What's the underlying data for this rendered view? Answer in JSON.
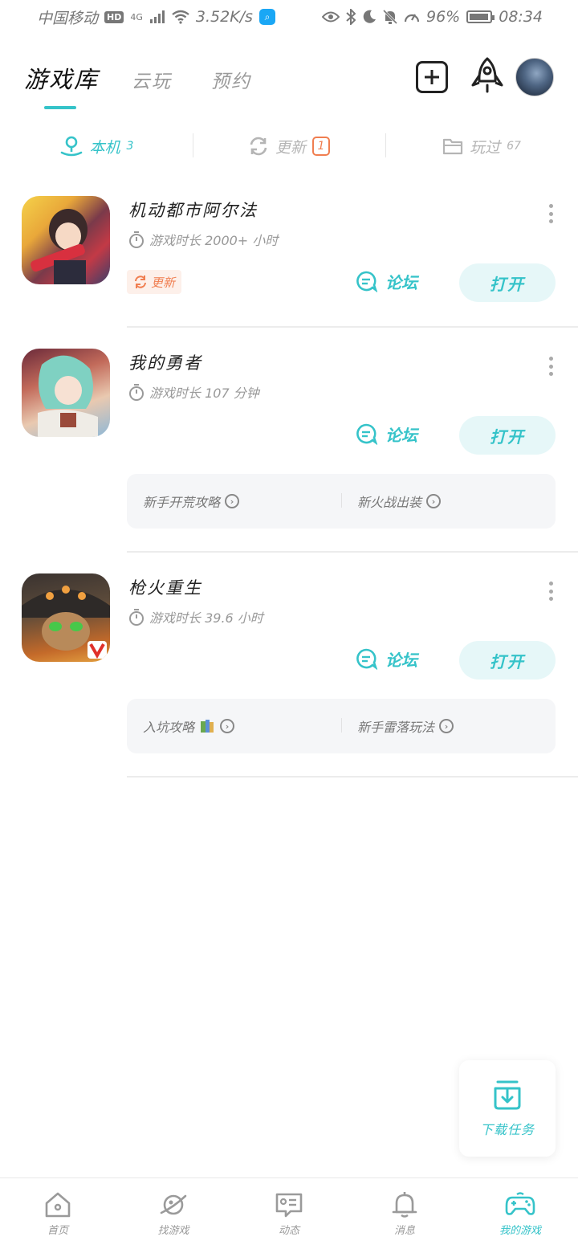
{
  "status_bar": {
    "carrier": "中国移动",
    "hd": "HD",
    "signal": "4G",
    "speed": "3.52K/s",
    "battery": "96%",
    "time": "08:34"
  },
  "header": {
    "tabs": [
      {
        "label": "游戏库",
        "active": true
      },
      {
        "label": "云玩",
        "active": false
      },
      {
        "label": "预约",
        "active": false
      }
    ]
  },
  "filters": [
    {
      "label": "本机",
      "count": "3",
      "active": true
    },
    {
      "label": "更新",
      "count": "1",
      "active": false
    },
    {
      "label": "玩过",
      "count": "67",
      "active": false
    }
  ],
  "games": [
    {
      "name": "机动都市阿尔法",
      "playtime": "游戏时长 2000+ 小时",
      "update_tag": "更新",
      "forum_label": "论坛",
      "open_label": "打开",
      "guides": []
    },
    {
      "name": "我的勇者",
      "playtime": "游戏时长 107 分钟",
      "forum_label": "论坛",
      "open_label": "打开",
      "guides": [
        "新手开荒攻略",
        "新火战出装"
      ]
    },
    {
      "name": "枪火重生",
      "playtime": "游戏时长 39.6 小时",
      "forum_label": "论坛",
      "open_label": "打开",
      "guides": [
        "入坑攻略",
        "新手雷落玩法"
      ]
    }
  ],
  "download_float": {
    "label": "下载任务"
  },
  "bottom_nav": [
    {
      "label": "首页",
      "icon": "home-icon",
      "active": false
    },
    {
      "label": "找游戏",
      "icon": "planet-icon",
      "active": false
    },
    {
      "label": "动态",
      "icon": "feed-icon",
      "active": false
    },
    {
      "label": "消息",
      "icon": "bell-icon",
      "active": false
    },
    {
      "label": "我的游戏",
      "icon": "gamepad-icon",
      "active": true
    }
  ],
  "colors": {
    "accent": "#35c3c9",
    "update": "#f07e50",
    "muted": "#9a9a9a"
  }
}
